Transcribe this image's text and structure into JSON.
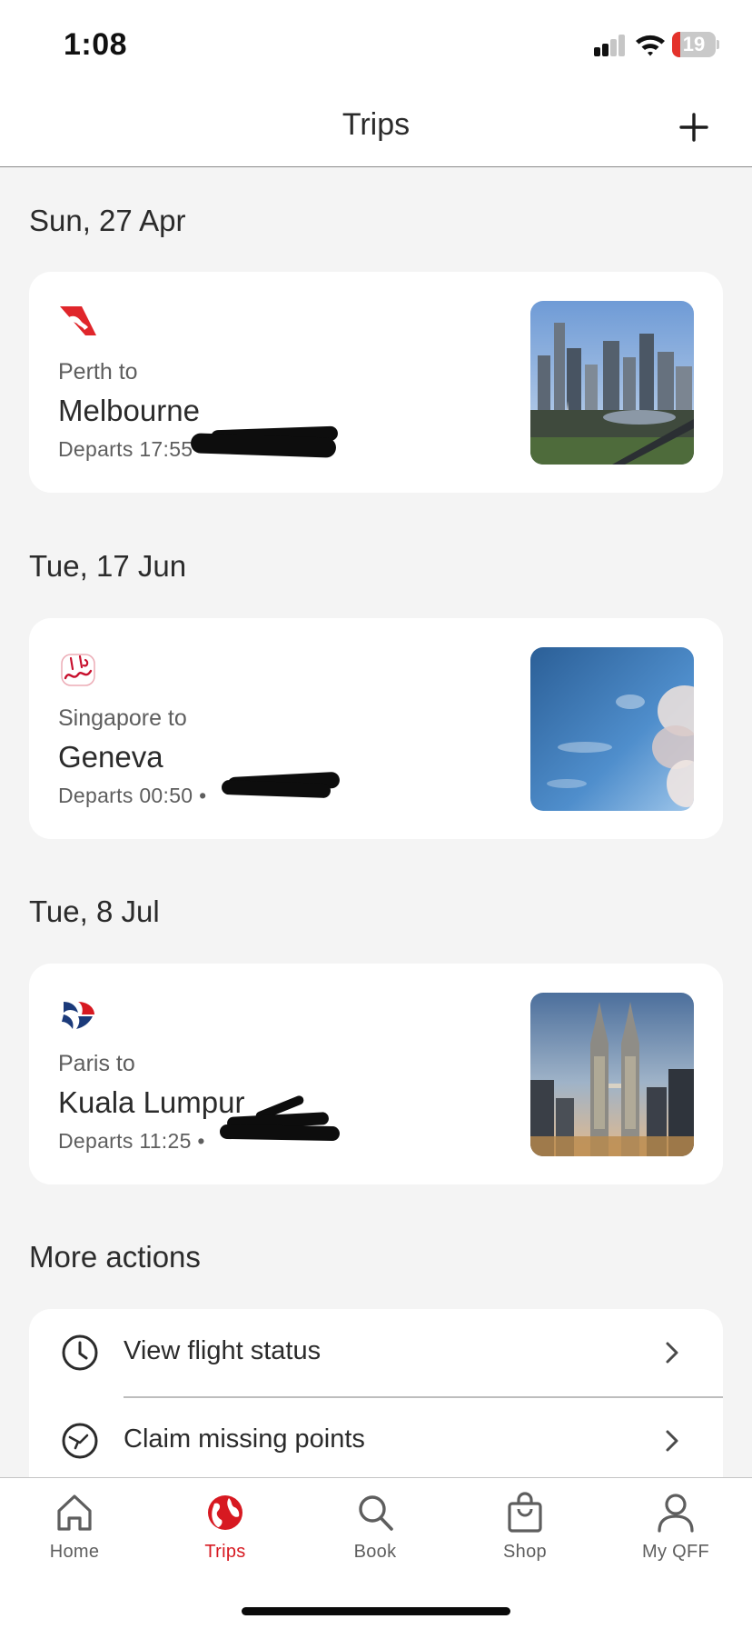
{
  "status_bar": {
    "time": "1:08",
    "battery": "19",
    "battery_level": 0.19
  },
  "header": {
    "title": "Trips"
  },
  "trips": [
    {
      "date": "Sun, 27 Apr",
      "airline_icon": "qantas-kangaroo-icon",
      "from": "Perth to",
      "to": "Melbourne",
      "departs": "Departs 17:55",
      "photo": "melbourne-skyline-photo"
    },
    {
      "date": "Tue, 17 Jun",
      "airline_icon": "emirates-calligraphy-icon",
      "from": "Singapore to",
      "to": "Geneva",
      "departs": "Departs 00:50 •",
      "photo": "sky-clouds-photo"
    },
    {
      "date": "Tue, 8 Jul",
      "airline_icon": "malaysia-airlines-kite-icon",
      "from": "Paris to",
      "to": "Kuala Lumpur",
      "departs": "Departs 11:25 •",
      "photo": "petronas-towers-photo"
    }
  ],
  "more_actions": {
    "title": "More actions",
    "items": [
      {
        "label": "View flight status",
        "icon": "clock-icon"
      },
      {
        "label": "Claim missing points",
        "icon": "clock-plane-icon"
      }
    ]
  },
  "tabs": [
    {
      "label": "Home",
      "icon": "home-icon",
      "active": false
    },
    {
      "label": "Trips",
      "icon": "globe-icon",
      "active": true
    },
    {
      "label": "Book",
      "icon": "search-icon",
      "active": false
    },
    {
      "label": "Shop",
      "icon": "shopping-bag-icon",
      "active": false
    },
    {
      "label": "My QFF",
      "icon": "user-icon",
      "active": false
    }
  ],
  "colors": {
    "accent": "#d71921",
    "background": "#f4f4f4",
    "card": "#ffffff",
    "text": "#2b2b2b",
    "muted": "#5e5e5e"
  }
}
